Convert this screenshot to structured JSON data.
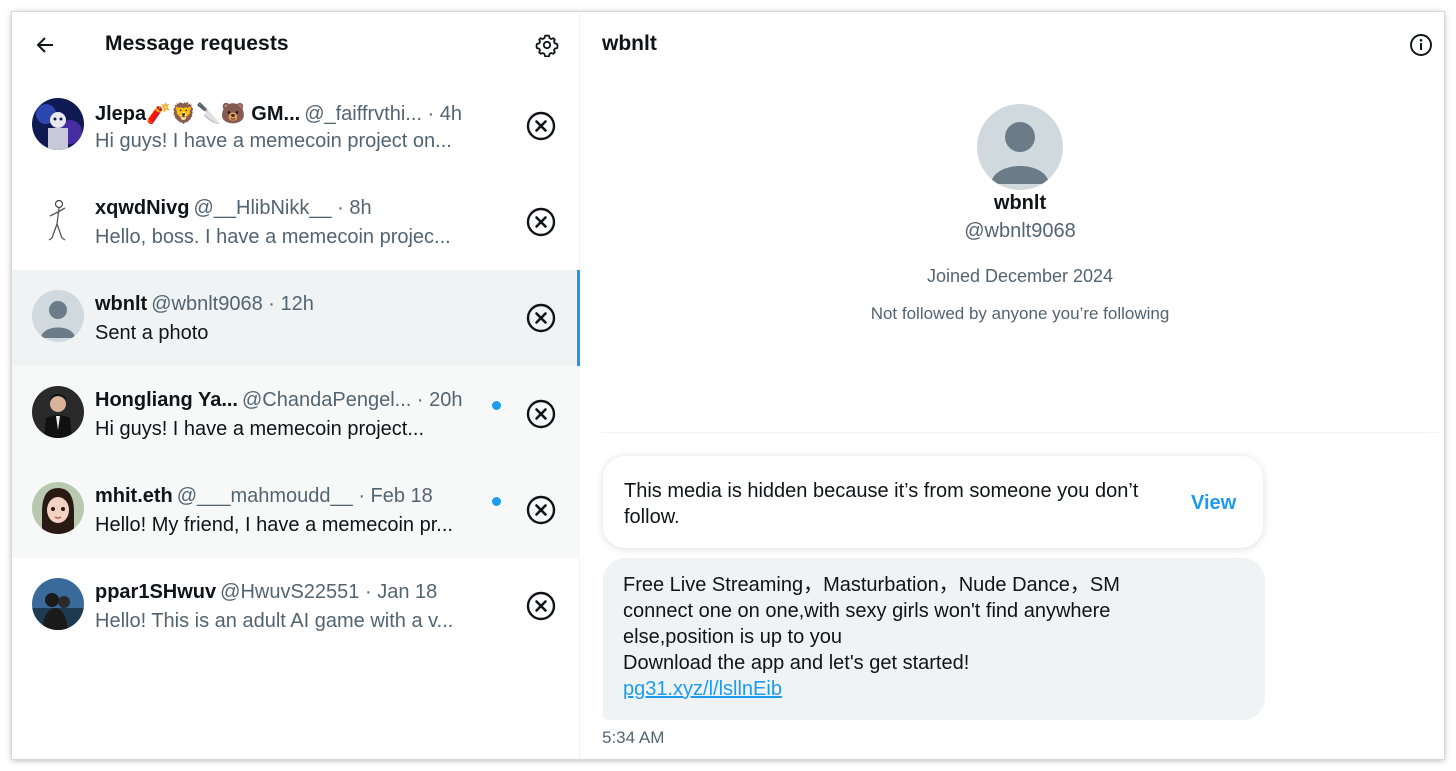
{
  "left_header": {
    "title": "Message requests"
  },
  "requests": [
    {
      "name": "Jlepa🧨🦁🔪🐻 GM...",
      "handle": "@_faiffrvthi...",
      "time": " · 4h",
      "preview": "Hi guys! I have a memecoin project on...",
      "unread": false,
      "state": "normal"
    },
    {
      "name": "xqwdNivg",
      "handle": "@__HlibNikk__",
      "time": " · 8h",
      "preview": "Hello, boss. I have a memecoin projec...",
      "unread": false,
      "state": "normal"
    },
    {
      "name": "wbnlt",
      "handle": "@wbnlt9068",
      "time": " · 12h",
      "preview": "Sent a photo",
      "unread": false,
      "state": "selected"
    },
    {
      "name": "Hongliang Ya...",
      "handle": "@ChandaPengel...",
      "time": "  · 20h",
      "preview": "Hi guys! I have a memecoin project...",
      "unread": true,
      "state": "gray"
    },
    {
      "name": "mhit.eth",
      "handle": "@___mahmoudd__",
      "time": " · Feb 18",
      "preview": "Hello! My friend, I have a memecoin pr...",
      "unread": true,
      "state": "gray"
    },
    {
      "name": "ppar1SHwuv",
      "handle": "@HwuvS22551",
      "time": " · Jan 18",
      "preview": "Hello! This is an adult AI game with a v...",
      "unread": false,
      "state": "normal"
    }
  ],
  "conversation": {
    "title": "wbnlt",
    "profile": {
      "name": "wbnlt",
      "handle": "@wbnlt9068",
      "joined": "Joined December 2024",
      "followed_by": "Not followed by anyone you’re following"
    },
    "hidden_media": {
      "text": "This media is hidden because it’s from someone you don’t follow.",
      "view_label": "View"
    },
    "message": {
      "line1": "Free Live Streaming，Masturbation，Nude Dance，SM",
      "line2": "connect one on one,with sexy girls won't find anywhere",
      "line3": "else,position is up to you",
      "line4": "Download the app and let's get started!",
      "link": "pg31.xyz/l/lsllnEib"
    },
    "time": "5:34 AM"
  },
  "colors": {
    "accent": "#1d9bf0",
    "text_primary": "#0f1419",
    "text_secondary": "#536471",
    "selected_bg": "#eff3f4",
    "hover_bg": "#f7f9f9"
  }
}
